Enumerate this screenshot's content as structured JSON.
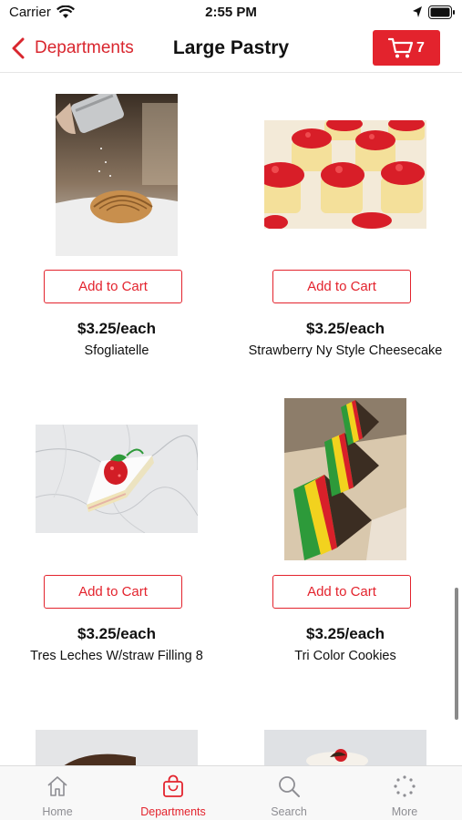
{
  "status_bar": {
    "carrier": "Carrier",
    "time": "2:55 PM"
  },
  "nav": {
    "back_label": "Departments",
    "title": "Large Pastry",
    "cart_count": "7"
  },
  "products": [
    {
      "add_label": "Add to Cart",
      "price": "$3.25/each",
      "name": "Sfogliatelle",
      "image": "sfogliatelle-photo"
    },
    {
      "add_label": "Add to Cart",
      "price": "$3.25/each",
      "name": "Strawberry Ny Style Cheesecake",
      "image": "cheesecake-photo"
    },
    {
      "add_label": "Add to Cart",
      "price": "$3.25/each",
      "name": "Tres Leches W/straw Filling 8",
      "image": "tres-leches-photo"
    },
    {
      "add_label": "Add to Cart",
      "price": "$3.25/each",
      "name": "Tri Color Cookies",
      "image": "tri-color-cookies-photo"
    }
  ],
  "tabs": [
    {
      "label": "Home",
      "icon": "home-icon",
      "active": false
    },
    {
      "label": "Departments",
      "icon": "shopping-bag-icon",
      "active": true
    },
    {
      "label": "Search",
      "icon": "search-icon",
      "active": false
    },
    {
      "label": "More",
      "icon": "more-dots-icon",
      "active": false
    }
  ],
  "colors": {
    "accent": "#e3232d",
    "inactive_tab": "#8e8e93"
  }
}
